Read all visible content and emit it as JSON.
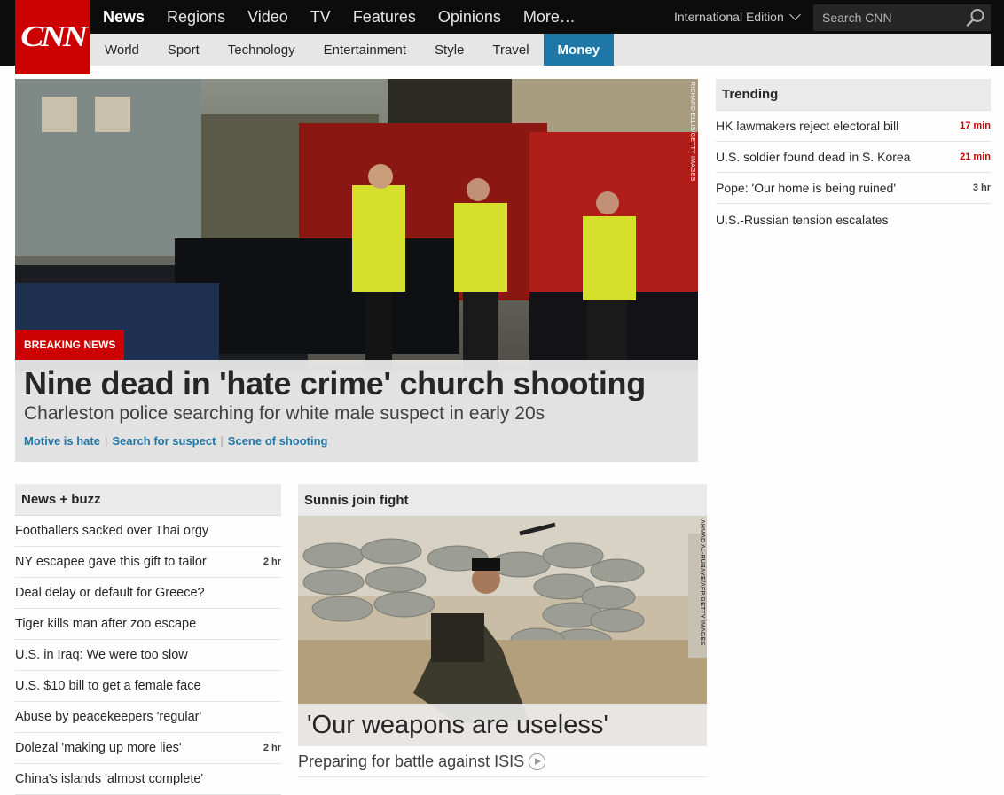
{
  "brand": {
    "logo_text": "CNN"
  },
  "main_nav": [
    {
      "label": "News",
      "active": true
    },
    {
      "label": "Regions"
    },
    {
      "label": "Video"
    },
    {
      "label": "TV"
    },
    {
      "label": "Features"
    },
    {
      "label": "Opinions"
    },
    {
      "label": "More…"
    }
  ],
  "edition": {
    "label": "International Edition"
  },
  "search": {
    "placeholder": "Search CNN"
  },
  "sub_nav": [
    {
      "label": "World"
    },
    {
      "label": "Sport"
    },
    {
      "label": "Technology"
    },
    {
      "label": "Entertainment"
    },
    {
      "label": "Style"
    },
    {
      "label": "Travel"
    },
    {
      "label": "Money",
      "active": true
    }
  ],
  "hero": {
    "photo_credit": "RICHARD ELLIS/GETTY IMAGES",
    "badge": "BREAKING NEWS",
    "headline": "Nine dead in 'hate crime' church shooting",
    "subhead": "Charleston police searching for white male suspect in early 20s",
    "links": [
      "Motive is hate",
      "Search for suspect",
      "Scene of shooting"
    ]
  },
  "trending": {
    "title": "Trending",
    "items": [
      {
        "text": "HK lawmakers reject electoral bill",
        "time": "17 min",
        "recent": true
      },
      {
        "text": "U.S. soldier found dead in S. Korea",
        "time": "21 min",
        "recent": true
      },
      {
        "text": "Pope: 'Our home is being ruined'",
        "time": "3 hr",
        "recent": false
      },
      {
        "text": "U.S.-Russian tension escalates",
        "time": ""
      }
    ]
  },
  "news_buzz": {
    "title": "News + buzz",
    "items": [
      {
        "text": "Footballers sacked over Thai orgy",
        "time": ""
      },
      {
        "text": "NY escapee gave this gift to tailor",
        "time": "2 hr"
      },
      {
        "text": "Deal delay or default for Greece?",
        "time": ""
      },
      {
        "text": "Tiger kills man after zoo escape",
        "time": ""
      },
      {
        "text": "U.S. in Iraq: We were too slow",
        "time": ""
      },
      {
        "text": "U.S. $10 bill to get a female face",
        "time": ""
      },
      {
        "text": "Abuse by peacekeepers 'regular'",
        "time": ""
      },
      {
        "text": "Dolezal 'making up more lies'",
        "time": "2 hr"
      },
      {
        "text": "China's islands 'almost complete'",
        "time": ""
      }
    ]
  },
  "sunnis": {
    "title": "Sunnis join fight",
    "photo_credit": "AHMAD AL-RUBAYE/AFP/GETTY IMAGES",
    "caption": "'Our weapons are useless'",
    "link": "Preparing for battle against ISIS"
  },
  "colors": {
    "brand_red": "#cc0000",
    "accent_blue": "#1f77a8",
    "header_black": "#0c0c0c"
  }
}
